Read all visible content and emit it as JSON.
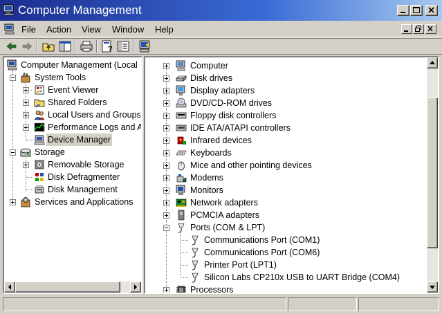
{
  "window": {
    "title": "Computer Management"
  },
  "menu": {
    "items": [
      "File",
      "Action",
      "View",
      "Window",
      "Help"
    ]
  },
  "toolbar": {
    "buttons": [
      "back-icon",
      "forward-icon",
      "up-folder-icon",
      "show-hide-tree-icon",
      "print-icon",
      "properties-icon",
      "help-icon",
      "scan-hardware-icon"
    ]
  },
  "tree": {
    "root": "Computer Management (Local",
    "system_tools": "System Tools",
    "event_viewer": "Event Viewer",
    "shared_folders": "Shared Folders",
    "local_users": "Local Users and Groups",
    "perf_logs": "Performance Logs and A",
    "device_manager": "Device Manager",
    "storage": "Storage",
    "removable_storage": "Removable Storage",
    "disk_defrag": "Disk Defragmenter",
    "disk_management": "Disk Management",
    "services": "Services and Applications"
  },
  "devices": {
    "categories": [
      "Computer",
      "Disk drives",
      "Display adapters",
      "DVD/CD-ROM drives",
      "Floppy disk controllers",
      "IDE ATA/ATAPI controllers",
      "Infrared devices",
      "Keyboards",
      "Mice and other pointing devices",
      "Modems",
      "Monitors",
      "Network adapters",
      "PCMCIA adapters",
      "Ports (COM & LPT)",
      "Processors"
    ],
    "ports": [
      "Communications Port (COM1)",
      "Communications Port (COM6)",
      "Printer Port (LPT1)",
      "Silicon Labs CP210x USB to UART Bridge (COM4)"
    ]
  },
  "status": {
    "cells": [
      "",
      "",
      ""
    ]
  }
}
